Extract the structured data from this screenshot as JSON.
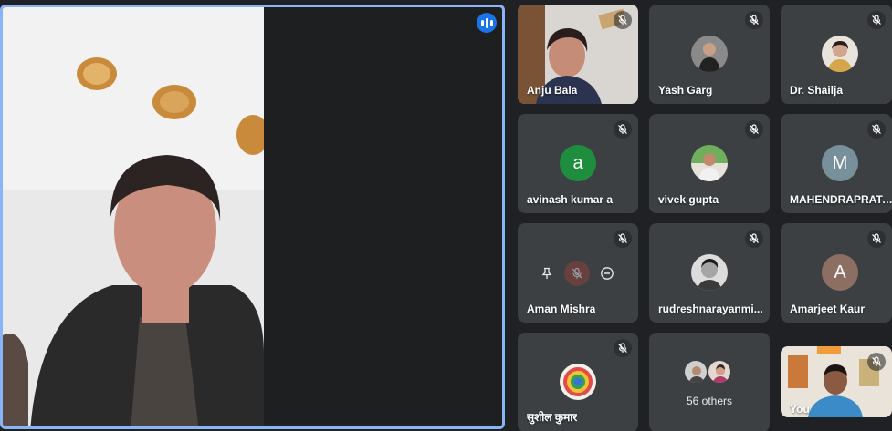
{
  "main": {
    "name": "",
    "speaking": true
  },
  "participants": [
    {
      "name": "Anju Bala",
      "muted": true,
      "type": "video"
    },
    {
      "name": "Yash Garg",
      "muted": true,
      "type": "photo"
    },
    {
      "name": "Dr. Shailja",
      "muted": true,
      "type": "photo"
    },
    {
      "name": "avinash kumar a",
      "muted": true,
      "type": "initial",
      "initial": "a",
      "color": "#1e8e3e"
    },
    {
      "name": "vivek gupta",
      "muted": true,
      "type": "photo"
    },
    {
      "name": "MAHENDRAPRATA...",
      "muted": true,
      "type": "initial",
      "initial": "M",
      "color": "#78909c"
    },
    {
      "name": "Aman Mishra",
      "muted": true,
      "type": "hovered"
    },
    {
      "name": "rudreshnarayanmi...",
      "muted": true,
      "type": "photo"
    },
    {
      "name": "Amarjeet Kaur",
      "muted": true,
      "type": "initial",
      "initial": "A",
      "color": "#8d6e63"
    },
    {
      "name": "सुशील कुमार",
      "muted": true,
      "type": "photo"
    },
    {
      "name": "",
      "muted": false,
      "type": "others",
      "others_label": "56 others"
    },
    {
      "name": "You",
      "muted": true,
      "type": "video"
    }
  ],
  "colors": {
    "active_speaker_border": "#8ab4f8",
    "background": "#202124",
    "tile": "#3c4043"
  }
}
